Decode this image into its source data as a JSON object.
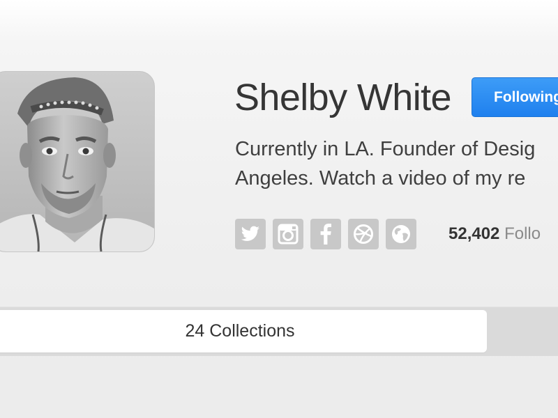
{
  "profile": {
    "name": "Shelby White",
    "follow_button_label": "Following",
    "bio_line_1": "Currently in LA. Founder of Desig",
    "bio_line_2": "Angeles. Watch a video of my re",
    "followers_count": "52,402",
    "followers_label": "Follo"
  },
  "social": {
    "icons": [
      "twitter-icon",
      "instagram-icon",
      "facebook-icon",
      "dribbble-icon",
      "globe-icon"
    ]
  },
  "tabs": {
    "collections_label": "24 Collections"
  },
  "colors": {
    "accent": "#1f80ee",
    "social_icon_bg": "#c8c8c8",
    "tab_bar_bg": "#dadada",
    "text_primary": "#353535",
    "text_muted": "#8a8a8a"
  }
}
